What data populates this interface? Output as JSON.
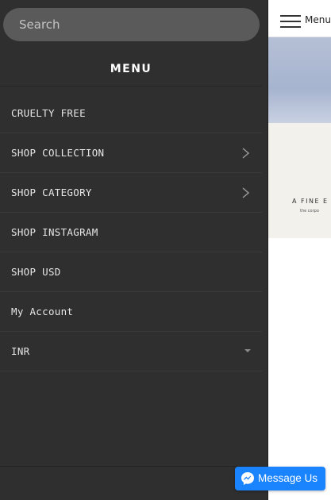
{
  "sidebar": {
    "search": {
      "placeholder": "Search",
      "value": ""
    },
    "title": "MENU",
    "items": [
      {
        "label": "CRUELTY FREE",
        "indicator": "none"
      },
      {
        "label": "SHOP COLLECTION",
        "indicator": "chevron-right-icon"
      },
      {
        "label": "SHOP CATEGORY",
        "indicator": "chevron-right-icon"
      },
      {
        "label": "SHOP INSTAGRAM",
        "indicator": "none"
      },
      {
        "label": "SHOP USD",
        "indicator": "none"
      },
      {
        "label": "My Account",
        "indicator": "none"
      },
      {
        "label": "INR",
        "indicator": "caret-down-icon"
      }
    ]
  },
  "page": {
    "menu_label": "Menu",
    "hero_text": "A FINE E",
    "hero_subtext": "the corpo"
  },
  "messenger": {
    "label": "Message Us",
    "icon": "messenger-icon"
  },
  "colors": {
    "sidebar_bg": "#2f2f2f",
    "search_bg": "#5a5a5a",
    "messenger_blue": "#1a84ff"
  }
}
